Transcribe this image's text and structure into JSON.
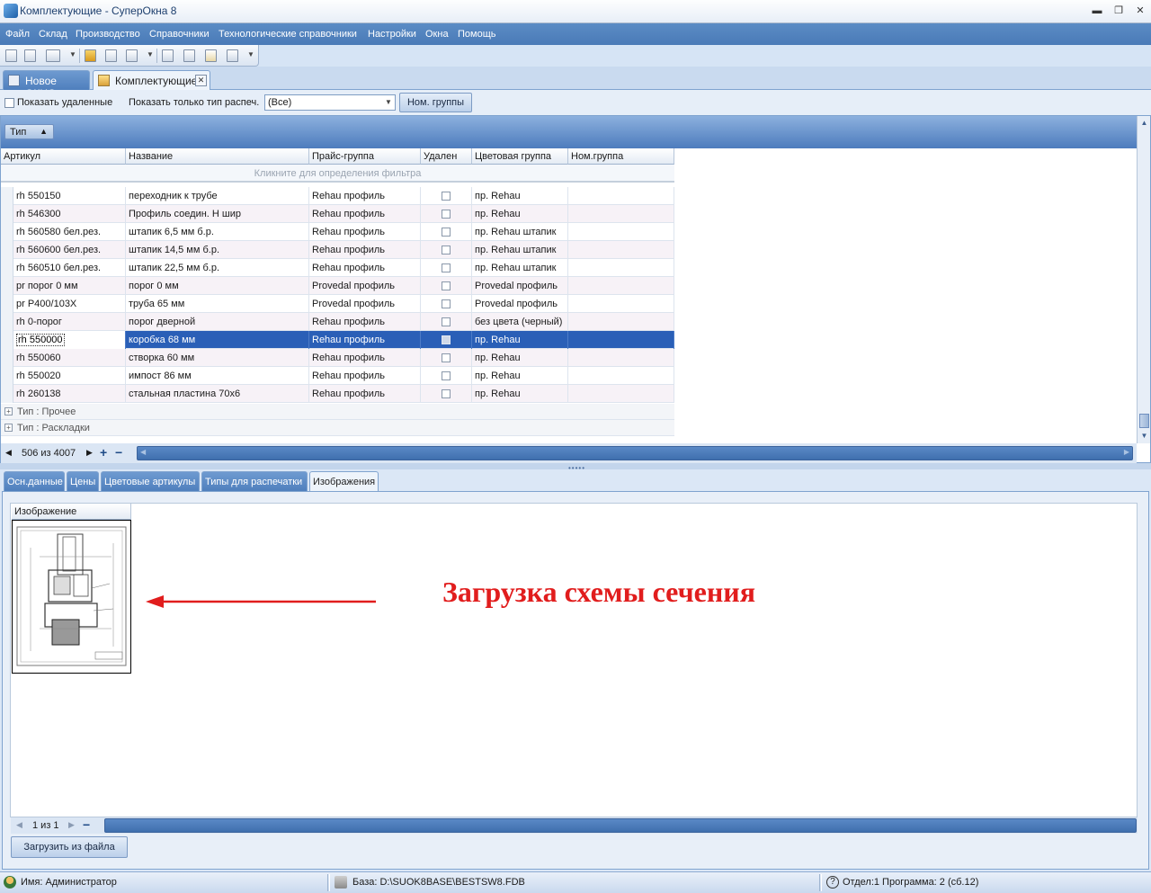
{
  "window": {
    "title": "Комплектующие - СуперОкна 8",
    "min_glyph": "▬",
    "max_glyph": "❐",
    "close_glyph": "✕"
  },
  "menu": [
    "Файл",
    "Склад",
    "Производство",
    "Справочники",
    "Технологические справочники",
    "Настройки",
    "Окна",
    "Помощь"
  ],
  "doc_tabs": [
    {
      "label": "Новое ОКНО",
      "active": false
    },
    {
      "label": "Комплектующие",
      "active": true
    }
  ],
  "filter_bar": {
    "show_deleted_label": "Показать удаленные",
    "print_type_label": "Показать только тип распеч.",
    "print_type_value": "(Все)",
    "nom_groups_button": "Ном. группы"
  },
  "grid": {
    "group_chip": "Тип",
    "columns": [
      "Артикул",
      "Название",
      "Прайс-группа",
      "Удален",
      "Цветовая группа",
      "Ном.группа"
    ],
    "filter_hint": "Кликните для определения фильтра",
    "rows": [
      {
        "article": "rh 550150",
        "name": "переходник к трубе",
        "price_group": "Rehau профиль",
        "deleted": false,
        "color_group": "пр. Rehau",
        "nom_group": ""
      },
      {
        "article": "rh 546300",
        "name": "Профиль соедин. Н шир",
        "price_group": "Rehau профиль",
        "deleted": false,
        "color_group": "пр. Rehau",
        "nom_group": ""
      },
      {
        "article": "rh 560580 бел.рез.",
        "name": "штапик 6,5 мм б.р.",
        "price_group": "Rehau профиль",
        "deleted": false,
        "color_group": "пр. Rehau штапик",
        "nom_group": ""
      },
      {
        "article": "rh 560600 бел.рез.",
        "name": "штапик 14,5 мм б.р.",
        "price_group": "Rehau профиль",
        "deleted": false,
        "color_group": "пр. Rehau штапик",
        "nom_group": ""
      },
      {
        "article": "rh 560510 бел.рез.",
        "name": "штапик 22,5 мм б.р.",
        "price_group": "Rehau профиль",
        "deleted": false,
        "color_group": "пр. Rehau штапик",
        "nom_group": ""
      },
      {
        "article": "pr порог 0 мм",
        "name": "порог 0 мм",
        "price_group": "Provedal профиль",
        "deleted": false,
        "color_group": "Provedal профиль",
        "nom_group": ""
      },
      {
        "article": "pr P400/103X",
        "name": "труба 65 мм",
        "price_group": "Provedal профиль",
        "deleted": false,
        "color_group": "Provedal профиль",
        "nom_group": ""
      },
      {
        "article": "rh 0-порог",
        "name": "порог дверной",
        "price_group": "Rehau профиль",
        "deleted": false,
        "color_group": "без цвета (черный)",
        "nom_group": ""
      },
      {
        "article": "rh 550000",
        "name": "коробка 68 мм",
        "price_group": "Rehau профиль",
        "deleted": false,
        "color_group": "пр. Rehau",
        "nom_group": "",
        "selected": true
      },
      {
        "article": "rh 550060",
        "name": "створка 60 мм",
        "price_group": "Rehau профиль",
        "deleted": false,
        "color_group": "пр. Rehau",
        "nom_group": ""
      },
      {
        "article": "rh 550020",
        "name": "импост 86 мм",
        "price_group": "Rehau профиль",
        "deleted": false,
        "color_group": "пр. Rehau",
        "nom_group": ""
      },
      {
        "article": "rh 260138",
        "name": "стальная пластина 70х6",
        "price_group": "Rehau профиль",
        "deleted": false,
        "color_group": "пр. Rehau",
        "nom_group": ""
      }
    ],
    "collapsed_groups": [
      "Тип : Прочее",
      "Тип : Раскладки"
    ],
    "record_counter": "506 из 4007"
  },
  "panel_tabs": [
    {
      "label": "Осн.данные",
      "active": false
    },
    {
      "label": "Цены",
      "active": false
    },
    {
      "label": "Цветовые артикулы",
      "active": false
    },
    {
      "label": "Типы для распечатки",
      "active": false
    },
    {
      "label": "Изображения",
      "active": true
    }
  ],
  "images_panel": {
    "column_header": "Изображение",
    "annotation": "Загрузка схемы сечения",
    "counter": "1 из 1",
    "load_button": "Загрузить из файла"
  },
  "status_bar": {
    "user": "Имя: Администратор",
    "database": "База: D:\\SUOK8BASE\\BESTSW8.FDB",
    "program": "Отдел:1 Программа: 2 (сб.12)"
  },
  "colors": {
    "menu_bg": "#4a7ab7",
    "selection": "#2a5fb7",
    "annotation_text": "#e11d1d",
    "panel_bg": "#dbe7f6"
  }
}
